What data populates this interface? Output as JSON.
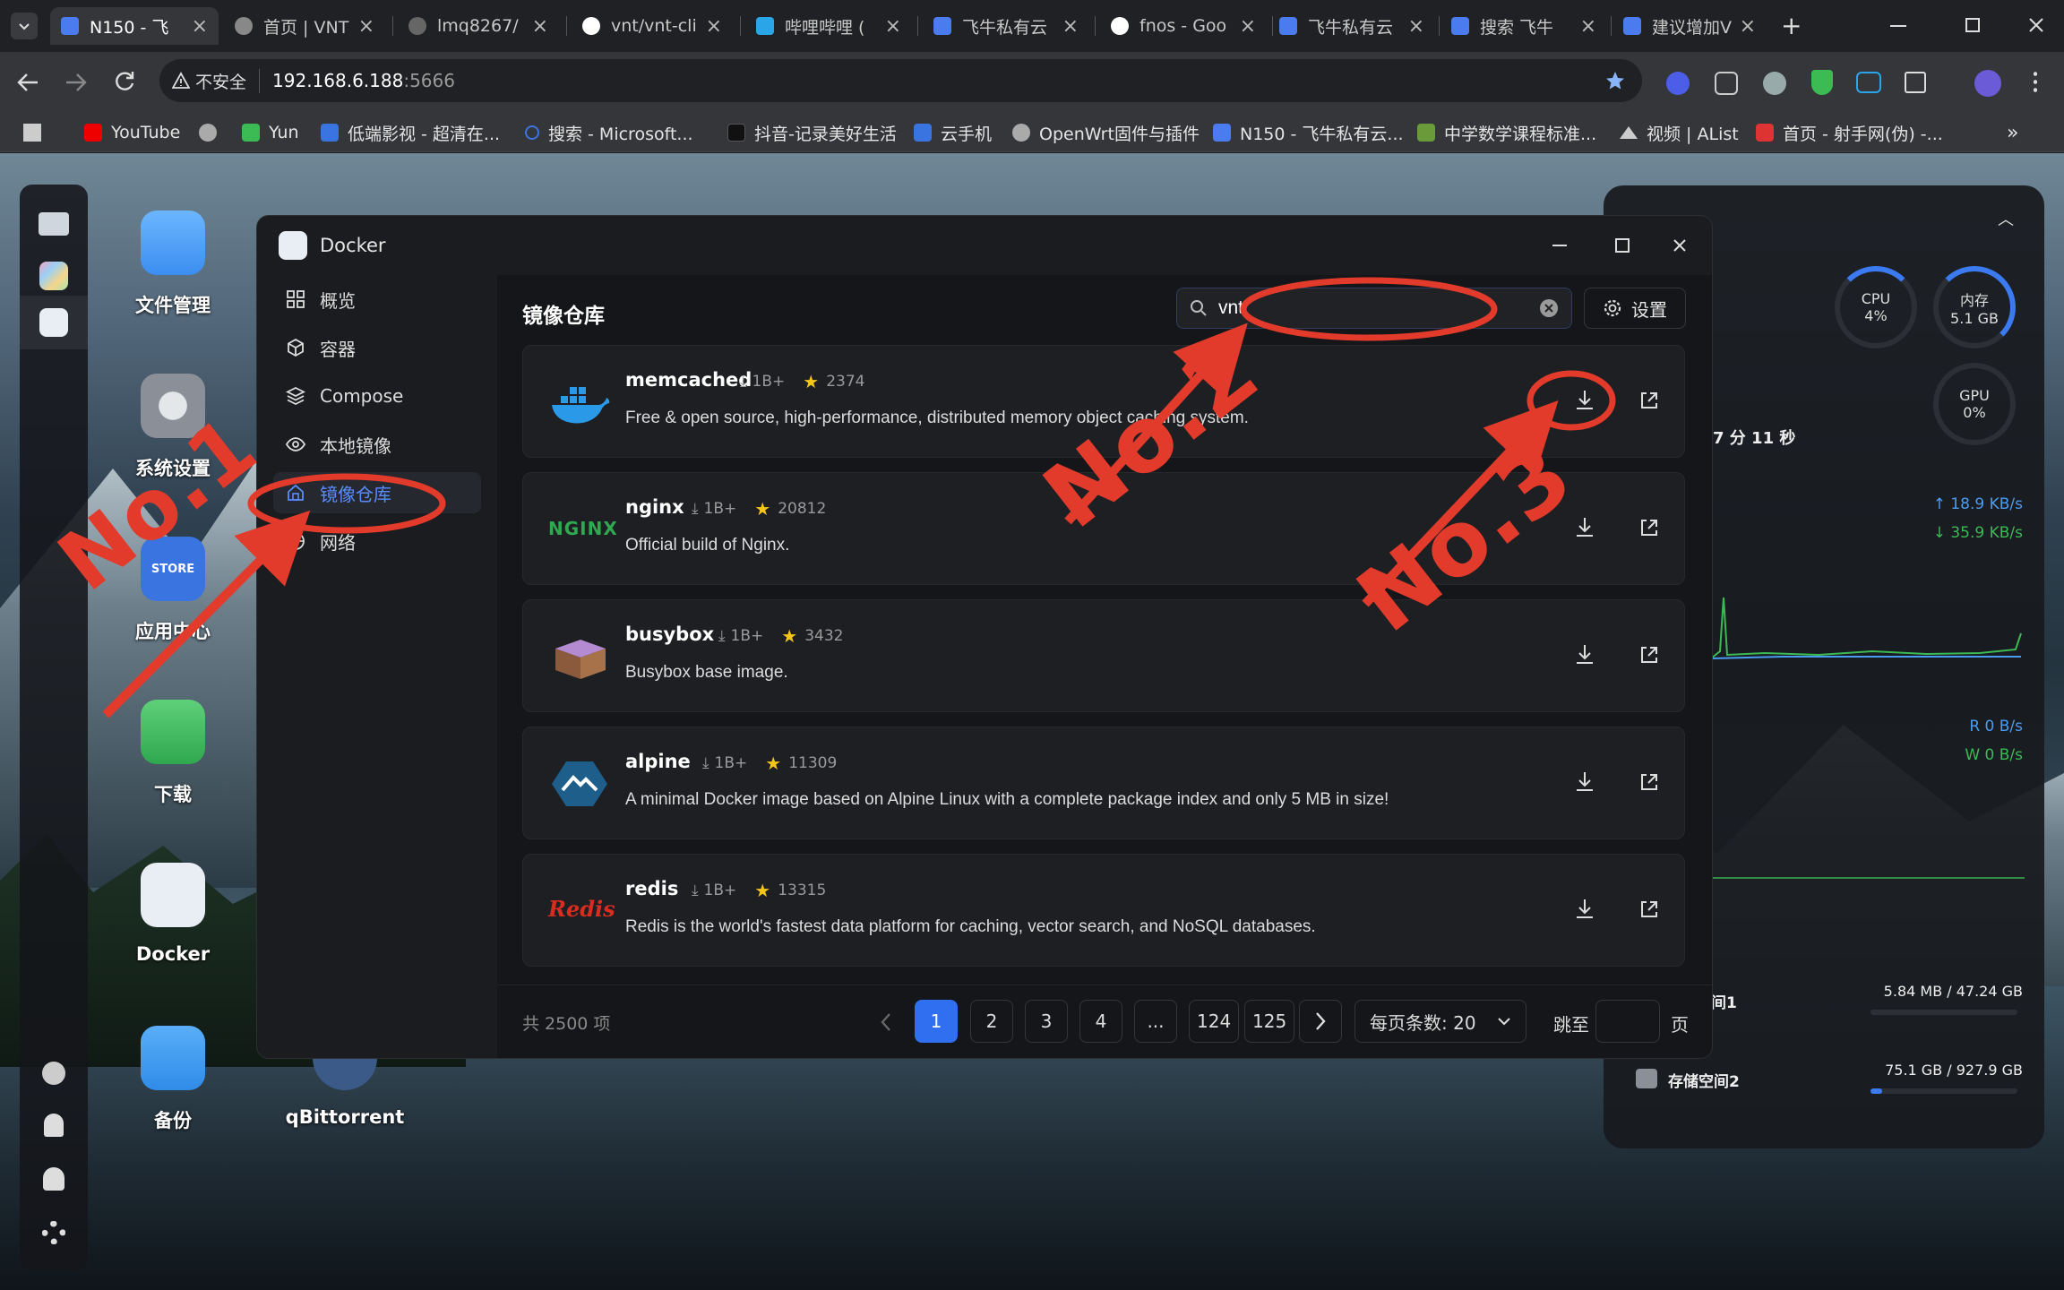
{
  "browser": {
    "tabs": [
      {
        "title": "N150 - 飞",
        "fav": "#4a7cf0"
      },
      {
        "title": "首页 | VNT",
        "fav": "#888"
      },
      {
        "title": "lmq8267/",
        "fav": "#666"
      },
      {
        "title": "vnt/vnt-cli",
        "fav": "#fff"
      },
      {
        "title": "哔哩哔哩 (",
        "fav": "#2aa6e8"
      },
      {
        "title": "飞牛私有云",
        "fav": "#4a7cf0"
      },
      {
        "title": "fnos - Goo",
        "fav": "#fff"
      },
      {
        "title": "飞牛私有云",
        "fav": "#4a7cf0"
      },
      {
        "title": "搜索 飞牛",
        "fav": "#4a7cf0"
      },
      {
        "title": "建议增加V",
        "fav": "#4a7cf0"
      }
    ],
    "new_tab": "+",
    "security_label": "不安全",
    "url": "192.168.6.188",
    "url_port": ":5666",
    "bookmarks": [
      {
        "label": "YouTube",
        "color": "#e00"
      },
      {
        "label": "",
        "color": "#aaa"
      },
      {
        "label": "Yun",
        "color": "#3cba54"
      },
      {
        "label": "低端影视 - 超清在...",
        "color": "#3a74e0"
      },
      {
        "label": "搜索 - Microsoft...",
        "color": "#3a74e0"
      },
      {
        "label": "抖音-记录美好生活",
        "color": "#222"
      },
      {
        "label": "云手机",
        "color": "#3a74e0"
      },
      {
        "label": "OpenWrt固件与插件",
        "color": "#aaa"
      },
      {
        "label": "N150 - 飞牛私有云...",
        "color": "#4a7cf0"
      },
      {
        "label": "中学数学课程标准...",
        "color": "#6a9a3a"
      },
      {
        "label": "视频 | AList",
        "color": "#aaa"
      },
      {
        "label": "首页 - 射手网(伪) -...",
        "color": "#d33"
      }
    ]
  },
  "desktop": {
    "icons": [
      {
        "label": "文件管理",
        "color": "#4a9cf0"
      },
      {
        "label": "系统设置",
        "color": "#8a8f98"
      },
      {
        "label": "应用中心",
        "color": "#3a74e0"
      },
      {
        "label": "下载",
        "color": "#3cba54"
      },
      {
        "label": "Docker",
        "color": "#e8eef4"
      },
      {
        "label": "备份",
        "color": "#2f8ce8"
      },
      {
        "label": "qBittorrent",
        "color": "#3b5a88"
      }
    ],
    "store_badge": "STORE"
  },
  "widget": {
    "cpu_label": "CPU",
    "cpu_val": "4%",
    "mem_label": "内存",
    "mem_val": "5.1 GB",
    "gpu_label": "GPU",
    "gpu_val": "0%",
    "uptime": "7 分 11 秒",
    "net_up": "18.9 KB/s",
    "net_down": "35.9 KB/s",
    "disk_r": "R  0 B/s",
    "disk_w": "W  0 B/s",
    "storage1_label": "间1",
    "storage1_val": "5.84 MB / 47.24 GB",
    "storage2_label": "存储空间2",
    "storage2_val": "75.1 GB / 927.9 GB"
  },
  "docker": {
    "window_title": "Docker",
    "nav": [
      "概览",
      "容器",
      "Compose",
      "本地镜像",
      "镜像仓库",
      "网络"
    ],
    "section_title": "镜像仓库",
    "search_value": "vnt",
    "settings_label": "设置",
    "images": [
      {
        "name": "memcached",
        "pulls": "1B+",
        "stars": "2374",
        "desc": "Free & open source, high-performance, distributed memory object caching system."
      },
      {
        "name": "nginx",
        "pulls": "1B+",
        "stars": "20812",
        "desc": "Official build of Nginx."
      },
      {
        "name": "busybox",
        "pulls": "1B+",
        "stars": "3432",
        "desc": "Busybox base image."
      },
      {
        "name": "alpine",
        "pulls": "1B+",
        "stars": "11309",
        "desc": "A minimal Docker image based on Alpine Linux with a complete package index and only 5 MB in size!"
      },
      {
        "name": "redis",
        "pulls": "1B+",
        "stars": "13315",
        "desc": "Redis is the world's fastest data platform for caching, vector search, and NoSQL databases."
      }
    ],
    "nginx_logo_text": "NGINX",
    "redis_logo_text": "Redis",
    "total": "共 2500 项",
    "pages": [
      "1",
      "2",
      "3",
      "4",
      "...",
      "124",
      "125"
    ],
    "per_page": "每页条数: 20",
    "jump_label": "跳至",
    "page_unit": "页"
  },
  "annotations": {
    "no1": "No.1",
    "no2": "No.2",
    "no3": "No.3"
  }
}
